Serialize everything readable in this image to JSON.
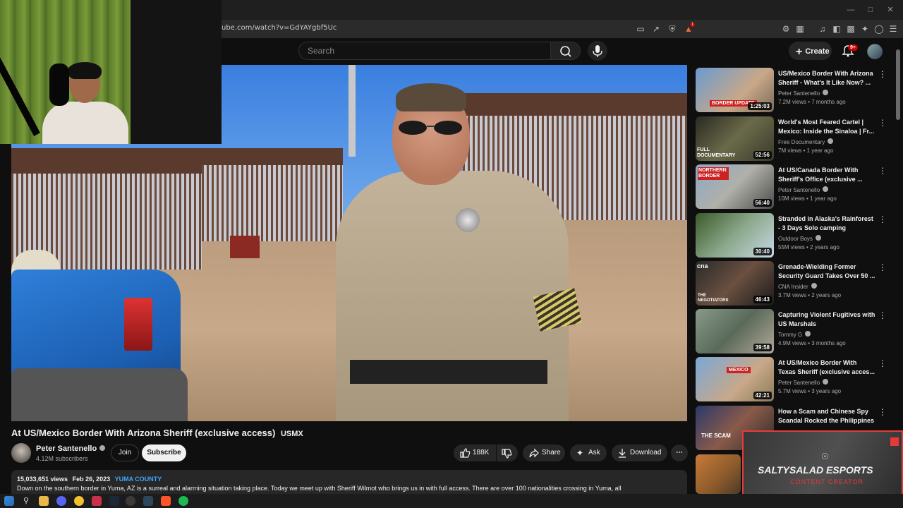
{
  "browser": {
    "url": "ube.com/watch?v=GdYAYgbf5Uc",
    "notification_count": "1"
  },
  "youtube": {
    "search_placeholder": "Search",
    "create_label": "Create",
    "bell_badge": "9+"
  },
  "video": {
    "title": "At US/Mexico Border With Arizona Sheriff (exclusive access)",
    "title_tag": "USMX",
    "channel": "Peter Santenello",
    "subscribers": "4.12M subscribers",
    "join_label": "Join",
    "subscribe_label": "Subscribe",
    "likes": "188K",
    "share_label": "Share",
    "ask_label": "Ask",
    "download_label": "Download",
    "views": "15,033,651 views",
    "date": "Feb 26, 2023",
    "location_tag": "YUMA COUNTY",
    "description": "Down on the southern border in Yuma, AZ is a surreal and alarming situation taking place. Today we meet up with Sheriff Wilmot who brings us in with full access. There are over 100 nationalities crossing in Yuma, all"
  },
  "recommendations": [
    {
      "title": "US/Mexico Border With Arizona Sheriff - What's It Like Now? ...",
      "channel": "Peter Santenello",
      "meta": "7.2M views • 7 months ago",
      "duration": "1:25:03",
      "thumb_text": "BORDER UPDATE"
    },
    {
      "title": "World's Most Feared Cartel | Mexico: Inside the Sinaloa | Fr...",
      "channel": "Free Documentary",
      "meta": "7M views • 1 year ago",
      "duration": "52:56",
      "thumb_text": "FULL DOCUMENTARY"
    },
    {
      "title": "At US/Canada Border With Sheriff's Office (exclusive ...",
      "channel": "Peter Santenello",
      "meta": "10M views • 1 year ago",
      "duration": "56:40",
      "thumb_text": "NORTHERN BORDER"
    },
    {
      "title": "Stranded in Alaska's Rainforest - 3 Days Solo camping",
      "channel": "Outdoor Boys",
      "meta": "55M views • 2 years ago",
      "duration": "30:40",
      "thumb_text": ""
    },
    {
      "title": "Grenade-Wielding Former Security Guard Takes Over 50 ...",
      "channel": "CNA Insider",
      "meta": "3.7M views • 2 years ago",
      "duration": "46:43",
      "thumb_text": "THE NEGOTIATORS"
    },
    {
      "title": "Capturing Violent Fugitives with US Marshals",
      "channel": "Tommy G",
      "meta": "4.9M views • 3 months ago",
      "duration": "39:58",
      "thumb_text": ""
    },
    {
      "title": "At US/Mexico Border With Texas Sheriff (exclusive acces...",
      "channel": "Peter Santenello",
      "meta": "5.7M views • 3 years ago",
      "duration": "42:21",
      "thumb_text": "MEXICO"
    },
    {
      "title": "How a Scam and Chinese Spy Scandal Rocked the Philippines",
      "channel": "",
      "meta": "",
      "duration": "",
      "thumb_text": "THE SCAM"
    }
  ],
  "overlay": {
    "name": "SALTYSALAD ESPORTS",
    "role": "CONTENT CREATOR"
  },
  "colors": {
    "background": "#0f0f0f",
    "accent_blue": "#3ea6ff",
    "accent_red": "#e63a3a"
  }
}
